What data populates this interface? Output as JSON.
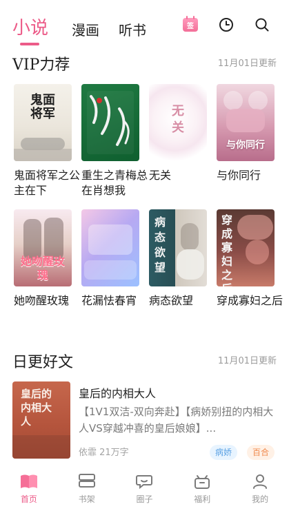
{
  "colors": {
    "accent": "#ec5b88",
    "muted": "#9b9b9b"
  },
  "top_tabs": [
    {
      "label": "小说",
      "active": true
    },
    {
      "label": "漫画"
    },
    {
      "label": "听书"
    }
  ],
  "top_icons": {
    "signin": "签",
    "history": "clock-icon",
    "search": "search-icon"
  },
  "vip": {
    "title": "VIP力荐",
    "updated": "11月01日更新",
    "books": [
      {
        "title": "鬼面将军之公主在下"
      },
      {
        "title": "重生之青梅总在肖想我"
      },
      {
        "title": "无关"
      },
      {
        "title": "与你同行"
      },
      {
        "title": "她吻醒玫瑰"
      },
      {
        "title": "花漏怯春宵"
      },
      {
        "title": "病态欲望"
      },
      {
        "title": "穿成寡妇之后"
      }
    ]
  },
  "covers": {
    "c1": "鬼面将军",
    "c3": "无关",
    "c4": "与你同行",
    "c5": "她吻醒玫瑰",
    "c7": "病态欲望",
    "c8": "穿成寡妇之后",
    "daily": "皇后的内相大人"
  },
  "daily": {
    "title": "日更好文",
    "updated": "11月01日更新",
    "book": {
      "title": "皇后的内相大人",
      "desc": "【1V1双洁-双向奔赴】【病娇别扭的内相大人VS穿越冲喜的皇后娘娘】...",
      "author_meta": "依霏 21万字",
      "tags": [
        "病娇",
        "百合"
      ]
    }
  },
  "bottom_nav": [
    {
      "label": "首页",
      "icon": "book-icon",
      "active": true
    },
    {
      "label": "书架",
      "icon": "bookshelf-icon"
    },
    {
      "label": "圈子",
      "icon": "chat-icon"
    },
    {
      "label": "福利",
      "icon": "gift-icon"
    },
    {
      "label": "我的",
      "icon": "user-icon"
    }
  ]
}
